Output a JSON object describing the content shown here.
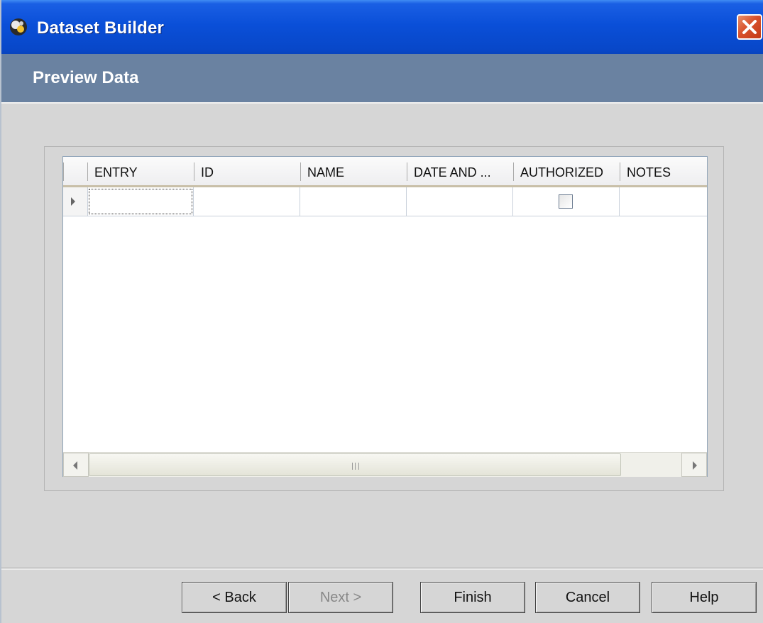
{
  "window": {
    "title": "Dataset Builder",
    "close_icon": "close-icon",
    "app_icon": "dataset-builder-icon"
  },
  "header": {
    "title": "Preview Data"
  },
  "grid": {
    "columns": [
      "ENTRY",
      "ID",
      "NAME",
      "DATE AND ...",
      "AUTHORIZED",
      "NOTES"
    ],
    "rows": [
      {
        "ENTRY": "",
        "ID": "",
        "NAME": "",
        "DATE AND ...": "",
        "AUTHORIZED": false,
        "NOTES": ""
      }
    ],
    "scrollbar": {
      "grip": "III"
    }
  },
  "buttons": {
    "back": "< Back",
    "next": "Next >",
    "finish": "Finish",
    "cancel": "Cancel",
    "help": "Help"
  },
  "colors": {
    "titlebar": "#0a4fd8",
    "header_band": "#6a82a1",
    "close_button": "#d8512c"
  }
}
